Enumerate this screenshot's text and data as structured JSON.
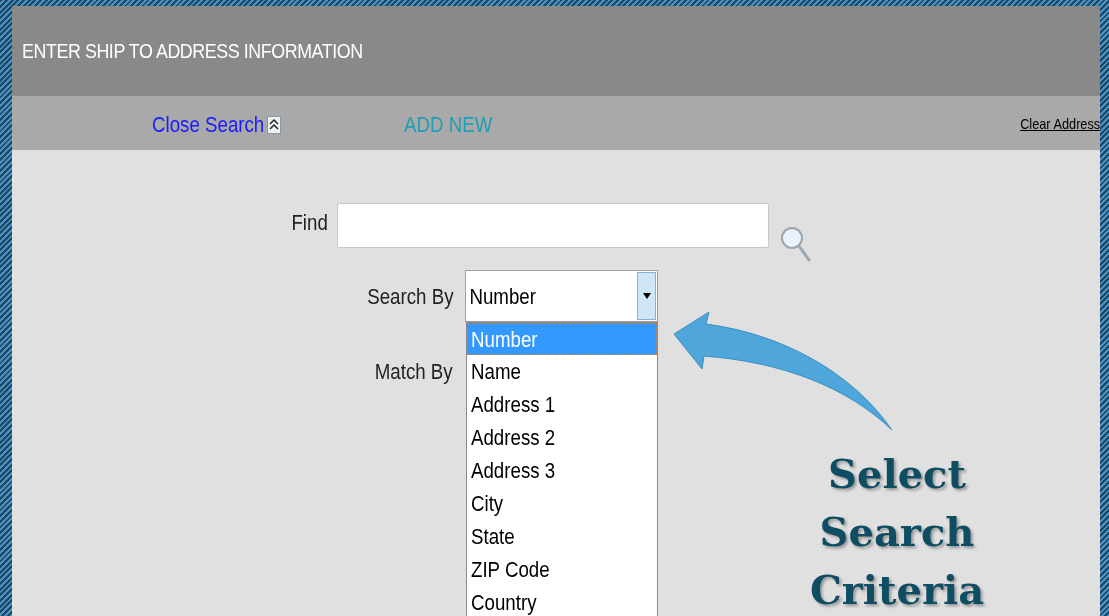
{
  "header": {
    "title": "ENTER SHIP TO ADDRESS INFORMATION"
  },
  "toolbar": {
    "links": [
      {
        "label": "Close Search",
        "kind": "collapse"
      },
      {
        "label": "ADD NEW",
        "kind": "add"
      },
      {
        "label": "Clear Address",
        "kind": "clear"
      }
    ]
  },
  "find": {
    "label": "Find"
  },
  "search_by": {
    "label": "Search By",
    "value": "Number",
    "expanded": true,
    "options": [
      {
        "label": "Number",
        "selected": true
      },
      {
        "label": "Name",
        "selected": false
      },
      {
        "label": "Address 1",
        "selected": false
      },
      {
        "label": "Address 2",
        "selected": false
      },
      {
        "label": "Address 3",
        "selected": false
      },
      {
        "label": "City",
        "selected": false
      },
      {
        "label": "State",
        "selected": false
      },
      {
        "label": "ZIP Code",
        "selected": false
      },
      {
        "label": "Country",
        "selected": false
      }
    ]
  },
  "match_by": {
    "label": "Match By"
  },
  "callout": {
    "lines": [
      "Select",
      "Search",
      "Criteria"
    ]
  }
}
